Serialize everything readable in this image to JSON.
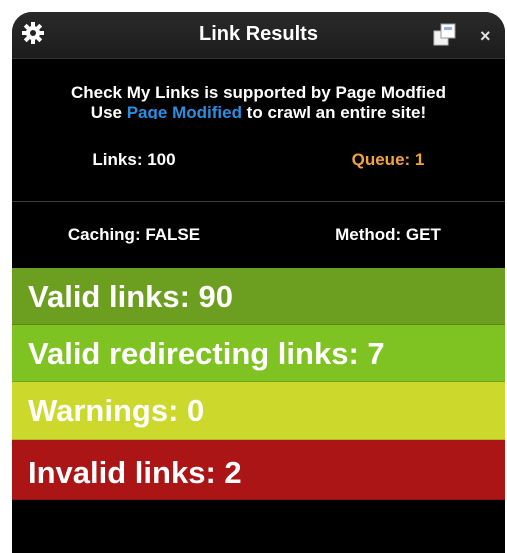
{
  "window": {
    "title": "Link Results",
    "close_label": "×",
    "icons": [
      "gear-icon",
      "popout-icon",
      "close-icon"
    ]
  },
  "info": {
    "line1": "Check My Links is supported by Page Modfied",
    "line2_prefix": "Use ",
    "line2_link": "Page Modified",
    "line2_suffix": " to crawl an entire site!"
  },
  "stats": {
    "links": "Links: 100",
    "queue": "Queue: 1",
    "caching": "Caching: FALSE",
    "method": "Method: GET"
  },
  "results": {
    "valid": "Valid links: 90",
    "redirecting": "Valid redirecting links: 7",
    "warnings": "Warnings: 0",
    "invalid": "Invalid links: 2"
  },
  "colors": {
    "valid": "#6c9f1f",
    "redirecting": "#7fc322",
    "warnings": "#cdd82c",
    "invalid": "#ab1515",
    "link": "#2a8fe0",
    "queue": "#f1a33c"
  }
}
